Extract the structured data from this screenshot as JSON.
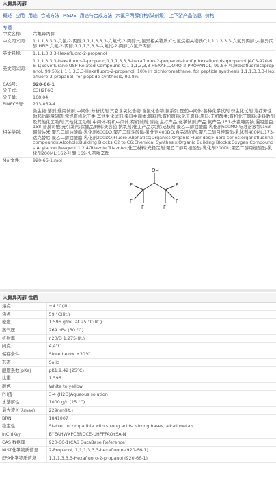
{
  "page_title": "六氟异丙醇",
  "nav": [
    "概述",
    "应用",
    "用途",
    "合成方法",
    "MSDS",
    "用途与合成方法",
    "六氟异丙醇价格(试剂级)",
    "上下游产品信息",
    "价格"
  ],
  "section_label": "专题",
  "basic": {
    "cn_name_label": "中文名称:",
    "cn_name": "六氟异丙醇",
    "cn_syn_label": "中文同义词:",
    "cn_syn": "1,1,1,3,3,3-六氟-2-丙醇;1,1,1,3,3,3-六氟代-2-丙醇;七氟异相关物质;C七氟烷相关物质C;1,1,1,3,3,3-六氟异丙醇;六氟异丙醇 HFIP;六氟-2-丙醇;1,1,1,3,3,3-六氟代-2-丙醇(六氟异丙醇)",
    "en_name_label": "英文名称:",
    "en_name": "1,1,1,3,3,3-Hexafluoro-2-propanol",
    "en_syn_label": "英文同义词:",
    "en_syn": "1,1,1,3,3,3-hexafluoro-2-propano;1,1,1,3,3,3-hexafluoro-2-propanolakahfip,hexafluoroisopropanol;JACS-920-66-1;Sevoflurane USP Related Compound C;1,1,1,3,3,3-HEXAFLUORO-2-PROPANOL, 99.8+ %;Hexafluoroisopropanol, 99.5%;1,1,1,3,3,3-Hexafluoro-2-propanol, 10% in dichloromethane, for peptide synthesis;1,1,1,3,3,3-Hexafluoro-2-propanol, for peptide synthesis, 99.8%",
    "cas_label": "CAS号:",
    "cas": "920-66-1",
    "formula_label": "分子式:",
    "formula": "C3H2F6O",
    "mw_label": "分子量:",
    "mw": "168.04",
    "einecs_label": "EINECS号:",
    "einecs": "213-059-4",
    "category_label": "相关类别:",
    "category": "微生物;溶剂;通用试剂;中间体;分析试剂;其它含氧化合物;含氟化合物;氟系列;医药中间体;各种化学试剂;衍生化试剂;治疗芳性勃起功能障碍药;常规有机化工类;其他生化试剂;染料中间体;原料药;有机原料;化工原料;原料;无机酸类;有机化工原料;染料助剂及其他化工助剂;其他化工助剂;中间体-有机中间体;有机试剂;醇类;主打产品;化学试剂;产品;氟产品;151-头孢噻肟钠;漏咀盖白;158-普莫司他;光引发剂;保健品原料;美容药;抗氧剂;化工产品;大货;成核剂;聚乙二醇油酸酯-乳化剂600MO;标准溶液物;163-硼替佐米;聚乙二醇油酸酯-乳化剂600DO;聚乙二醇油酸酯-乳化剂400DO;食品添加剂;聚乙二醇月桂酸酯-乳化剂400ML;173-达克替尼;聚乙二醇油酸酯-乳化剂200DO;Fluoro-Aliphatics;Organics;Organic Fluorides;Fluoro series;organofluorine compounds;Alcohols;Building Blocks;C2 to C6;Chemical Synthesis;Organic Building Blocks;Oxygen Compounds;Acylation Reagent;1,2,4-Triazole,Triazoles;化工材料;光稳定剂;聚乙二醇月桂酸酯-乳化剂200DL;聚乙二醇月桂酸酯-乳化剂200ML;162-叶酸;169-头孢呋辛酯",
    "mol_label": "Mol文件:",
    "mol": "920-66-1.mol"
  },
  "structure": {
    "atom_O": "OH",
    "atom_F": [
      "F",
      "F",
      "F",
      "F",
      "F",
      "F"
    ]
  },
  "props_title": "六氟异丙醇 性质",
  "properties": [
    {
      "k": "熔点",
      "v": "−4 °C(lit.)"
    },
    {
      "k": "沸点",
      "v": "59 °C(lit.)"
    },
    {
      "k": "密度",
      "v": "1.596 g/mL at 25 °C(lit.)"
    },
    {
      "k": "蒸气压",
      "v": "269 hPa (30 °C)"
    },
    {
      "k": "折射率",
      "v": "n20/D 1.275(lit.)"
    },
    {
      "k": "闪点",
      "v": "4,4°C"
    },
    {
      "k": "储存条件",
      "v": "Store below +30°C."
    },
    {
      "k": "形态",
      "v": "Solid"
    },
    {
      "k": "酸度系数(pKa)",
      "v": "pK1:9.42 (25°C)"
    },
    {
      "k": "比重",
      "v": "1.596"
    },
    {
      "k": "颜色",
      "v": "White to yellow"
    },
    {
      "k": "PH值",
      "v": "3-4 (H2O)Aqueous solution"
    },
    {
      "k": "水溶解性",
      "v": "1000 g/L (25 °C)"
    },
    {
      "k": "最大波长(λmax)",
      "v": "229nm(lit.)"
    },
    {
      "k": "BRN",
      "v": "1841007"
    },
    {
      "k": "稳定性",
      "v": "Stable. Incompatible with strong acids, strong bases, alkali metals."
    },
    {
      "k": "InChIKey",
      "v": "BYEAHWXPCBROCE-UHFFFAOYSA-N"
    },
    {
      "k": "CAS 数据库",
      "v": "920-66-1(CAS DataBase Reference)"
    },
    {
      "k": "NIST化学物质信息",
      "v": "2-Propanol, 1,1,1,3,3,3-hexafluoro-(920-66-1)"
    },
    {
      "k": "EPA化学物质信息",
      "v": "1,1,1,3,3,3-Hexafluoro-2-propanol (920-66-1)"
    }
  ]
}
